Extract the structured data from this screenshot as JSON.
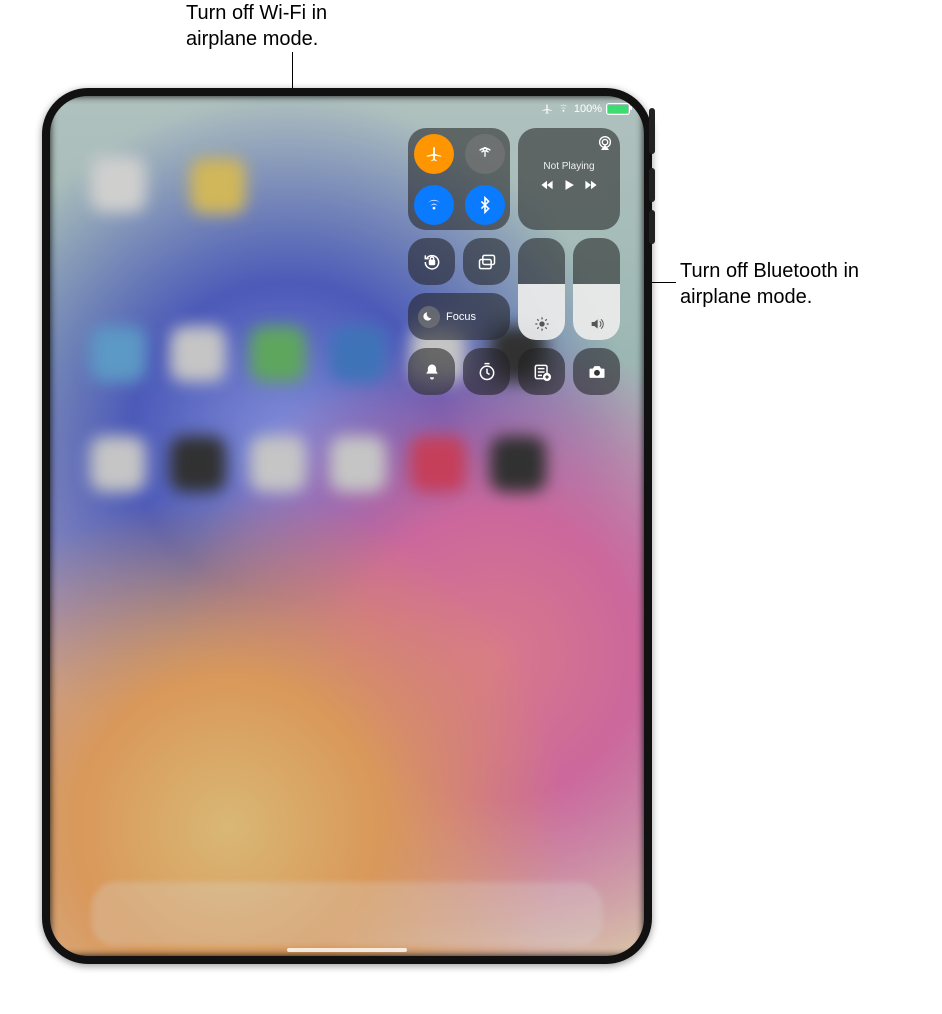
{
  "callouts": {
    "wifi": "Turn off Wi-Fi in airplane mode.",
    "bluetooth": "Turn off Bluetooth in airplane mode."
  },
  "status": {
    "battery_pct": "100%"
  },
  "control_center": {
    "connectivity": {
      "airplane_mode": {
        "on": true
      },
      "cellular": {
        "on": false
      },
      "wifi": {
        "on": true
      },
      "bluetooth": {
        "on": true
      }
    },
    "media": {
      "now_playing": "Not Playing"
    },
    "focus": {
      "label": "Focus"
    },
    "sliders": {
      "brightness_pct": 55,
      "volume_pct": 55
    }
  }
}
